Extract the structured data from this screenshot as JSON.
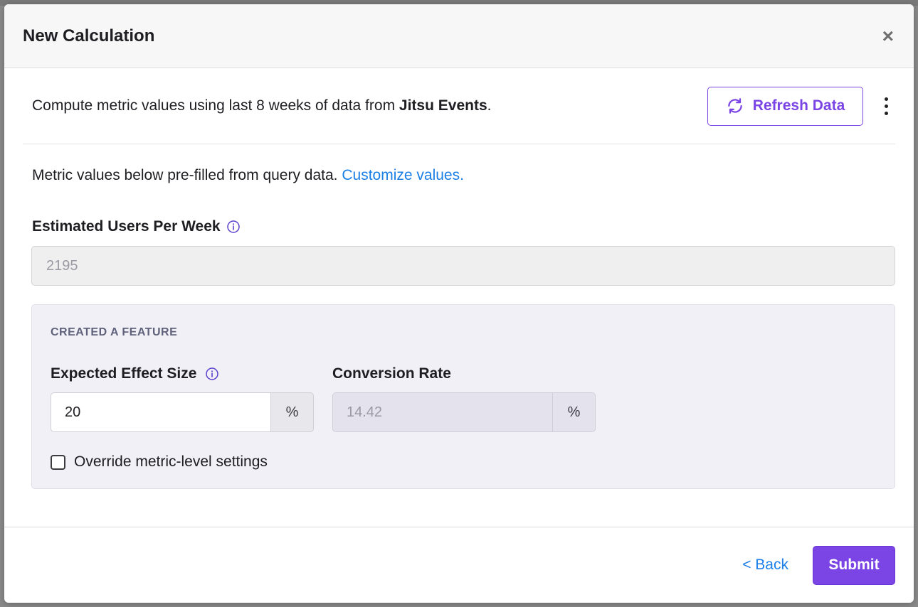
{
  "modal": {
    "title": "New Calculation",
    "close_glyph": "×"
  },
  "source": {
    "prefix": "Compute metric values using last 8 weeks of data from ",
    "datasource": "Jitsu Events",
    "suffix": ".",
    "refresh_label": "Refresh Data",
    "refresh_icon": "refresh-icon",
    "more_icon": "kebab-menu-icon"
  },
  "prefill": {
    "text": "Metric values below pre-filled from query data. ",
    "link": "Customize values."
  },
  "users": {
    "label": "Estimated Users Per Week",
    "value": "2195",
    "info_icon": "info-icon"
  },
  "metric": {
    "name": "CREATED A FEATURE",
    "effect_label": "Expected Effect Size",
    "effect_value": "20",
    "effect_unit": "%",
    "conversion_label": "Conversion Rate",
    "conversion_value": "14.42",
    "conversion_unit": "%",
    "override_label": "Override metric-level settings",
    "override_checked": false
  },
  "footer": {
    "back_label": "< Back",
    "submit_label": "Submit"
  },
  "colors": {
    "accent": "#7b45e5",
    "link": "#1a7fe6",
    "card_bg": "#f1f0f6"
  }
}
